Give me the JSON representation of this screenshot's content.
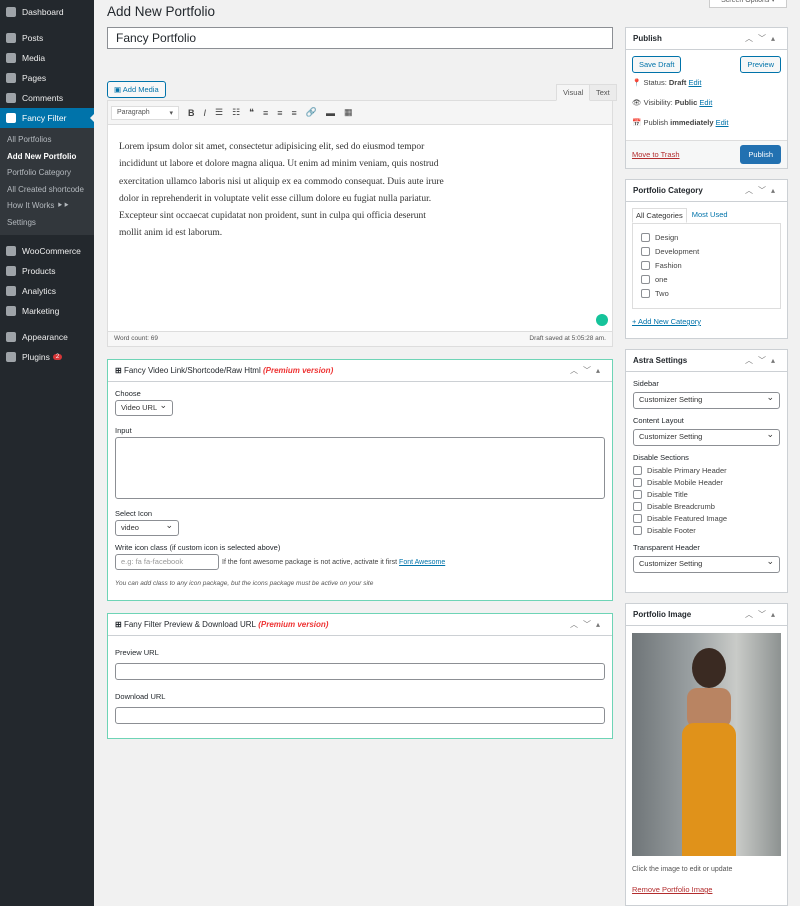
{
  "sidebar": {
    "items": [
      {
        "label": "Dashboard"
      },
      {
        "label": "Posts"
      },
      {
        "label": "Media"
      },
      {
        "label": "Pages"
      },
      {
        "label": "Comments"
      },
      {
        "label": "Fancy Filter"
      }
    ],
    "sub": [
      "All Portfolios",
      "Add New Portfolio",
      "Portfolio Category",
      "All Created shortcode",
      "How It Works ⯈⯈",
      "Settings"
    ],
    "items2": [
      {
        "label": "WooCommerce"
      },
      {
        "label": "Products"
      },
      {
        "label": "Analytics"
      },
      {
        "label": "Marketing"
      },
      {
        "label": "Appearance"
      },
      {
        "label": "Plugins",
        "badge": "2"
      }
    ]
  },
  "header": {
    "title": "Add New Portfolio",
    "screen_options": "Screen Options ▾"
  },
  "post_title": "Fancy Portfolio",
  "editor": {
    "add_media": "Add Media",
    "tab_visual": "Visual",
    "tab_text": "Text",
    "format": "Paragraph",
    "content": "Lorem ipsum dolor sit amet, consectetur adipisicing elit, sed do eiusmod tempor incididunt ut labore et dolore magna aliqua. Ut enim ad minim veniam, quis nostrud exercitation ullamco laboris nisi ut aliquip ex ea commodo consequat. Duis aute irure dolor in reprehenderit in voluptate velit esse cillum dolore eu fugiat nulla pariatur. Excepteur sint occaecat cupidatat non proident, sunt in culpa qui officia deserunt mollit anim id est laborum.",
    "word_count": "Word count: 69",
    "draft_saved": "Draft saved at 5:05:28 am."
  },
  "video_box": {
    "title": "Fancy Video Link/Shortcode/Raw Html",
    "premium": "(Premium version)",
    "choose_label": "Choose",
    "choose_value": "Video URL",
    "input_label": "Input",
    "input_value": "",
    "icon_label": "Select Icon",
    "icon_value": "video",
    "class_label": "Write icon class (if custom icon is selected above)",
    "class_placeholder": "e.g: fa fa-facebook",
    "class_note": "If the font awesome package is not active, activate it first",
    "class_link": "Font Awesome",
    "hint": "You can add class to any icon package, but the icons package must be active on your site"
  },
  "preview_box": {
    "title": "Fany Filter Preview & Download URL",
    "premium": "(Premium version)",
    "preview_label": "Preview URL",
    "preview_value": "",
    "download_label": "Download URL",
    "download_value": ""
  },
  "publish": {
    "title": "Publish",
    "save_draft": "Save Draft",
    "preview": "Preview",
    "status_label": "Status:",
    "status": "Draft",
    "visibility_label": "Visibility:",
    "visibility": "Public",
    "publish_label": "Publish",
    "publish_when": "immediately",
    "edit": "Edit",
    "trash": "Move to Trash",
    "publish_btn": "Publish"
  },
  "category": {
    "title": "Portfolio Category",
    "tab_all": "All Categories",
    "tab_used": "Most Used",
    "items": [
      "Design",
      "Development",
      "Fashion",
      "one",
      "Two"
    ],
    "add": "+ Add New Category"
  },
  "astra": {
    "title": "Astra Settings",
    "sidebar_label": "Sidebar",
    "sidebar_value": "Customizer Setting",
    "layout_label": "Content Layout",
    "layout_value": "Customizer Setting",
    "disable_label": "Disable Sections",
    "disable": [
      "Disable Primary Header",
      "Disable Mobile Header",
      "Disable Title",
      "Disable Breadcrumb",
      "Disable Featured Image",
      "Disable Footer"
    ],
    "transparent_label": "Transparent Header",
    "transparent_value": "Customizer Setting"
  },
  "image_box": {
    "title": "Portfolio Image",
    "hint": "Click the image to edit or update",
    "remove": "Remove Portfolio Image"
  }
}
